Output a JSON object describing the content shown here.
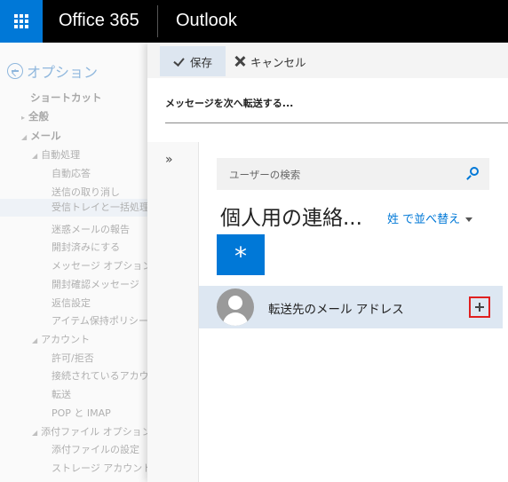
{
  "header": {
    "brand": "Office 365",
    "app": "Outlook",
    "waffle_icon": "app-launcher-icon"
  },
  "leftnav": {
    "title": "オプション",
    "items": [
      {
        "label": "ショートカット",
        "bold": true
      },
      {
        "label": "全般",
        "bold": true
      },
      {
        "label": "メール",
        "bold": true
      },
      {
        "label": "自動処理"
      },
      {
        "label": "自動応答"
      },
      {
        "label": "送信の取り消し"
      },
      {
        "label": "受信トレイと一括処理ル",
        "selected": true
      },
      {
        "label": "迷惑メールの報告"
      },
      {
        "label": "開封済みにする"
      },
      {
        "label": "メッセージ オプション"
      },
      {
        "label": "開封確認メッセージ"
      },
      {
        "label": "返信設定"
      },
      {
        "label": "アイテム保持ポリシー"
      },
      {
        "label": "アカウント"
      },
      {
        "label": "許可/拒否"
      },
      {
        "label": "接続されているアカウント"
      },
      {
        "label": "転送"
      },
      {
        "label": "POP と IMAP"
      },
      {
        "label": "添付ファイル オプション"
      },
      {
        "label": "添付ファイルの設定"
      },
      {
        "label": "ストレージ アカウント"
      }
    ]
  },
  "commands": {
    "save": "保存",
    "cancel": "キャンセル"
  },
  "form": {
    "forward_label": "メッセージを次へ転送する..."
  },
  "picker": {
    "collapse": "»",
    "search_placeholder": "ユーザーの検索",
    "group_title": "個人用の連絡...",
    "sort_label": "姓 で並べ替え",
    "tile": "*",
    "contact_name": "転送先のメール アドレス"
  },
  "colors": {
    "accent": "#0078d7",
    "highlight": "#e02020"
  }
}
